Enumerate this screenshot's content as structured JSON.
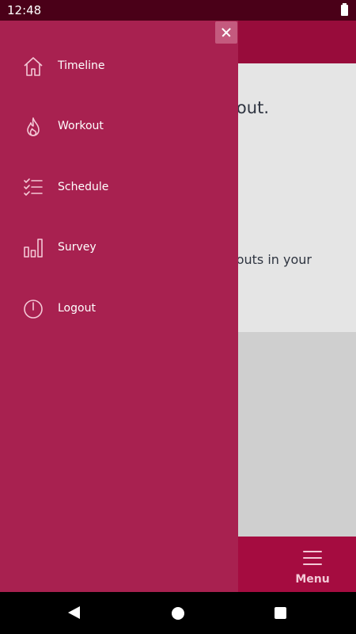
{
  "status_bar": {
    "time": "12:48"
  },
  "drawer": {
    "items": [
      {
        "label": "Timeline",
        "icon": "home-icon"
      },
      {
        "label": "Workout",
        "icon": "flame-icon"
      },
      {
        "label": "Schedule",
        "icon": "checklist-icon"
      },
      {
        "label": "Survey",
        "icon": "bar-chart-icon"
      },
      {
        "label": "Logout",
        "icon": "power-icon"
      }
    ]
  },
  "card": {
    "heading_visible": "out.",
    "text_visible": "outs in your"
  },
  "bottom_bar": {
    "menu_label": "Menu"
  },
  "colors": {
    "drawer_bg": "#a82150",
    "header_bg": "#980c3b",
    "bottom_bar_bg": "#a50c40",
    "status_bar_bg": "#4a0018"
  }
}
